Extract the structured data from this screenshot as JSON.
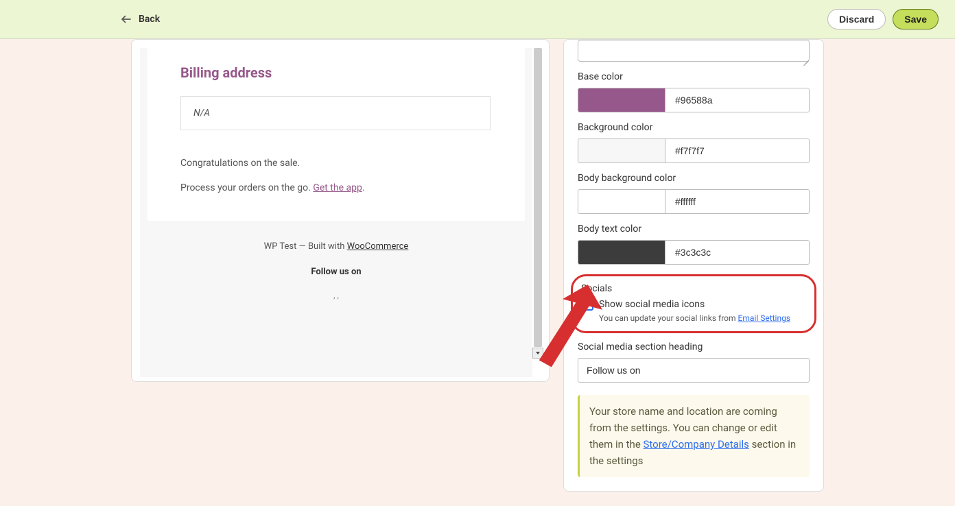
{
  "topbar": {
    "back": "Back",
    "discard": "Discard",
    "save": "Save"
  },
  "preview": {
    "billing_heading": "Billing address",
    "na": "N/A",
    "congrats": "Congratulations on the sale.",
    "process": "Process your orders on the go. ",
    "get_app": "Get the app",
    "footer_prefix": "WP Test — Built with ",
    "footer_link": "WooCommerce",
    "follow": "Follow us on",
    "commas": ", ,"
  },
  "panel": {
    "base_color_label": "Base color",
    "base_color_val": "#96588a",
    "bg_color_label": "Background color",
    "bg_color_val": "#f7f7f7",
    "body_bg_label": "Body background color",
    "body_bg_val": "#ffffff",
    "body_text_label": "Body text color",
    "body_text_val": "#3c3c3c",
    "socials_title": "Socials",
    "socials_checkbox": "Show social media icons",
    "socials_hint_pre": "You can update your social links from ",
    "socials_hint_link": "Email Settings",
    "social_heading_label": "Social media section heading",
    "social_heading_val": "Follow us on",
    "notice_pre": "Your store name and location are coming from the settings. You can change or edit them in the ",
    "notice_link": "Store/Company Details",
    "notice_post": " section in the settings"
  }
}
